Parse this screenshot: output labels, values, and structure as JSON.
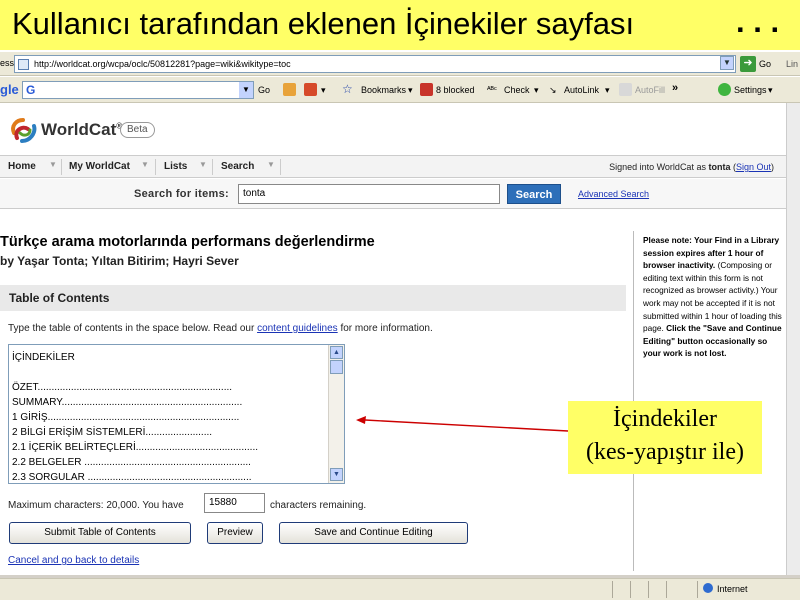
{
  "slide": {
    "title": "Kullanıcı tarafından eklenen İçinekiler sayfası",
    "dots": ". . .",
    "accent_color": "#ffff66"
  },
  "browser": {
    "address_label": "ess",
    "url": "http://worldcat.org/wcpa/oclc/50812281?page=wiki&wikitype=toc",
    "go_label": "Go",
    "links_label": "Lin",
    "google_toolbar": {
      "logo_text": "gle",
      "search_box": "G",
      "go_label": "Go",
      "bookmarks": "Bookmarks",
      "blocked": "8 blocked",
      "check": "Check",
      "autolink": "AutoLink",
      "autofill": "AutoFill",
      "more": "»",
      "settings": "Settings"
    },
    "status": {
      "zone": "Internet"
    }
  },
  "worldcat": {
    "logo_text": "WorldCat",
    "logo_mark": "®",
    "beta": "Beta",
    "nav": {
      "items": [
        "Home",
        "My WorldCat",
        "Lists",
        "Search"
      ],
      "signed_prefix": "Signed into WorldCat as",
      "username": "tonta",
      "sign_out": "Sign Out"
    },
    "search": {
      "label": "Search for items:",
      "value": "tonta",
      "button": "Search",
      "advanced": "Advanced Search"
    },
    "record": {
      "title": "Türkçe arama motorlarında performans değerlendirme",
      "author_prefix": "by",
      "authors": "Yaşar Tonta; Yıltan Bitirim; Hayri Sever"
    },
    "toc": {
      "heading": "Table of Contents",
      "instructions_pre": "Type the table of contents in the space below. Read our",
      "guidelines_link": "content guidelines",
      "instructions_post": "for more information.",
      "lines": [
        "İÇİNDEKİLER",
        "",
        "ÖZET......................................................................",
        "SUMMARY.................................................................",
        "1 GİRİŞ.....................................................................",
        "2 BİLGİ ERİŞİM SİSTEMLERİ........................",
        "2.1 İÇERİK BELİRTEÇLERİ............................................",
        "2.2 BELGELER ............................................................",
        "2.3 SORGULAR ..........................................................."
      ],
      "max_chars_text": "Maximum characters: 20,000. You have",
      "remaining_value": "15880",
      "remaining_label": "characters remaining.",
      "submit_button": "Submit Table of Contents",
      "preview_button": "Preview",
      "save_button": "Save and Continue Editing",
      "cancel_link": "Cancel and go back to details"
    },
    "note": {
      "bold1": "Please note: Your Find in a Library session expires after 1 hour of browser inactivity.",
      "normal": "(Composing or editing text within this form is not recognized as browser activity.) Your work may not be accepted if it is not submitted within 1 hour of loading this page.",
      "bold2": "Click the \"Save and Continue Editing\" button occasionally so your work is not lost."
    }
  },
  "callout": {
    "line1": "İçindekiler",
    "line2": "(kes-yapıştır ile)",
    "arrow_color": "#cc0000"
  }
}
